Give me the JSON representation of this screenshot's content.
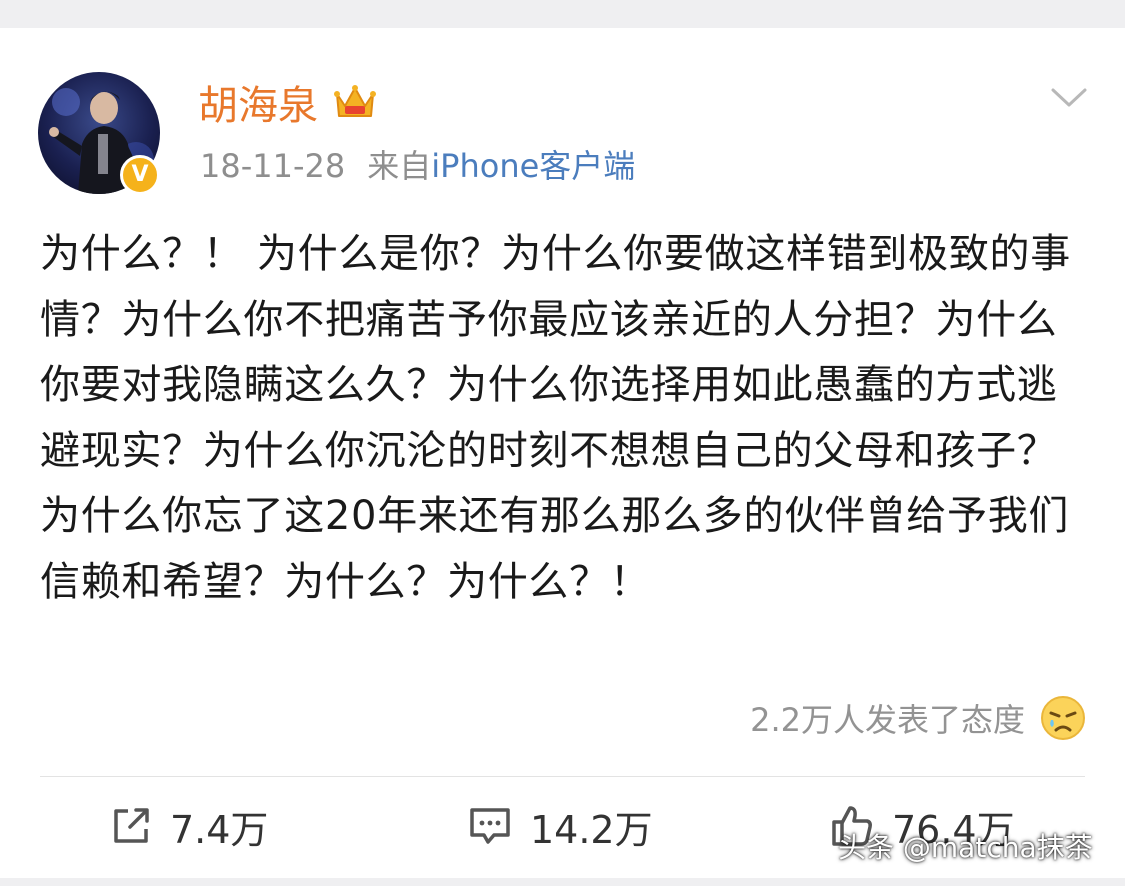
{
  "post": {
    "author": "胡海泉",
    "verified_badge": "V",
    "date": "18-11-28",
    "source_prefix": "来自",
    "source_link": "iPhone客户端",
    "text": "为什么？！ 为什么是你？为什么你要做这样错到极致的事情？为什么你不把痛苦予你最应该亲近的人分担？为什么你要对我隐瞒这么久？为什么你选择用如此愚蠢的方式逃避现实？为什么你沉沦的时刻不想想自己的父母和孩子？为什么你忘了这20年来还有那么那么多的伙伴曾给予我们信赖和希望？为什么？为什么？！",
    "reactions_text": "2.2万人发表了态度"
  },
  "actions": {
    "repost_count": "7.4万",
    "comment_count": "14.2万",
    "like_count": "76.4万"
  },
  "watermark": "头条 @matcha抹茶",
  "icons": [
    "crown-icon",
    "chevron-down-icon",
    "crying-emoji-icon",
    "repost-icon",
    "comment-icon",
    "like-icon"
  ],
  "colors": {
    "username": "#e8782c",
    "link": "#4b7dbd",
    "muted": "#8e8e8e",
    "body_text": "#1a1a1a",
    "badge": "#f5b21b"
  }
}
